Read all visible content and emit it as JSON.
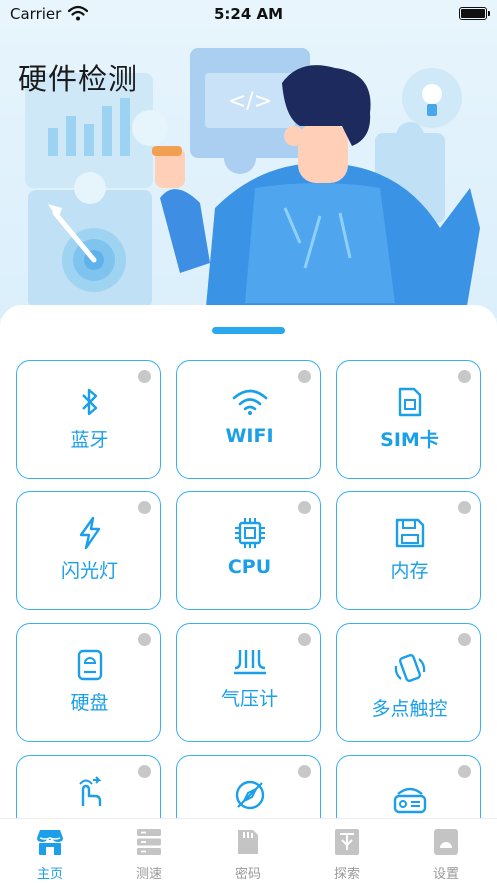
{
  "status_bar": {
    "carrier": "Carrier",
    "time": "5:24 AM"
  },
  "header": {
    "title": "硬件检测",
    "code_tag": "</>"
  },
  "features": [
    {
      "label": "蓝牙",
      "icon": "bluetooth-icon"
    },
    {
      "label": "WIFI",
      "icon": "wifi-icon"
    },
    {
      "label": "SIM卡",
      "icon": "sim-card-icon"
    },
    {
      "label": "闪光灯",
      "icon": "flash-icon"
    },
    {
      "label": "CPU",
      "icon": "cpu-icon"
    },
    {
      "label": "内存",
      "icon": "memory-icon"
    },
    {
      "label": "硬盘",
      "icon": "hard-disk-icon"
    },
    {
      "label": "气压计",
      "icon": "barometer-icon"
    },
    {
      "label": "多点触控",
      "icon": "multi-touch-icon"
    },
    {
      "label": "",
      "icon": "gesture-icon"
    },
    {
      "label": "",
      "icon": "compass-icon"
    },
    {
      "label": "",
      "icon": "radio-icon"
    }
  ],
  "tabs": [
    {
      "label": "主页",
      "icon": "home-store-icon",
      "active": true
    },
    {
      "label": "测速",
      "icon": "server-icon",
      "active": false
    },
    {
      "label": "密码",
      "icon": "sd-card-icon",
      "active": false
    },
    {
      "label": "探索",
      "icon": "explore-icon",
      "active": false
    },
    {
      "label": "设置",
      "icon": "settings-icon",
      "active": false
    }
  ],
  "colors": {
    "accent": "#1b9fe9",
    "border": "#38b0ee",
    "inactive": "#999999",
    "dot": "#c8c8c8",
    "banner_bg": "#e6f4fc"
  }
}
